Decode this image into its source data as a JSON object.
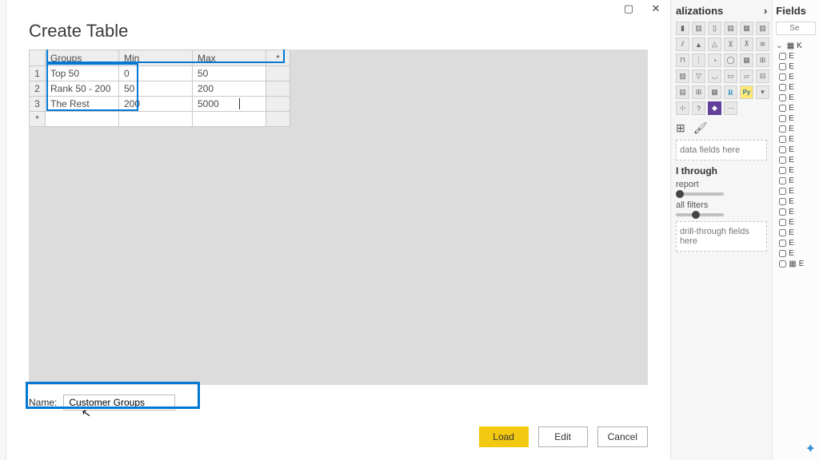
{
  "dialog": {
    "title": "Create Table",
    "window_buttons": {
      "maximize": "▢",
      "close": "✕"
    },
    "columns": {
      "groups": "Groups",
      "min": "Min",
      "max": "Max",
      "star": "*"
    },
    "rows": [
      {
        "n": "1",
        "groups": "Top 50",
        "min": "0",
        "max": "50"
      },
      {
        "n": "2",
        "groups": "Rank 50 - 200",
        "min": "50",
        "max": "200"
      },
      {
        "n": "3",
        "groups": "The Rest",
        "min": "200",
        "max": "5000"
      }
    ],
    "empty_row": "*",
    "name_label": "Name:",
    "name_value": "Customer Groups",
    "buttons": {
      "load": "Load",
      "edit": "Edit",
      "cancel": "Cancel"
    }
  },
  "viz": {
    "title": "alizations",
    "chevron": "›",
    "drop_text": "data fields here",
    "drill_header": "I through",
    "cross_report": "report",
    "keep_filters": "all filters",
    "drill_drop": "drill-through fields here",
    "r_label": "R",
    "py_label": "Py"
  },
  "fields": {
    "title": "Fields",
    "search_placeholder": "Se",
    "root_label": "K",
    "item_label": "E"
  }
}
